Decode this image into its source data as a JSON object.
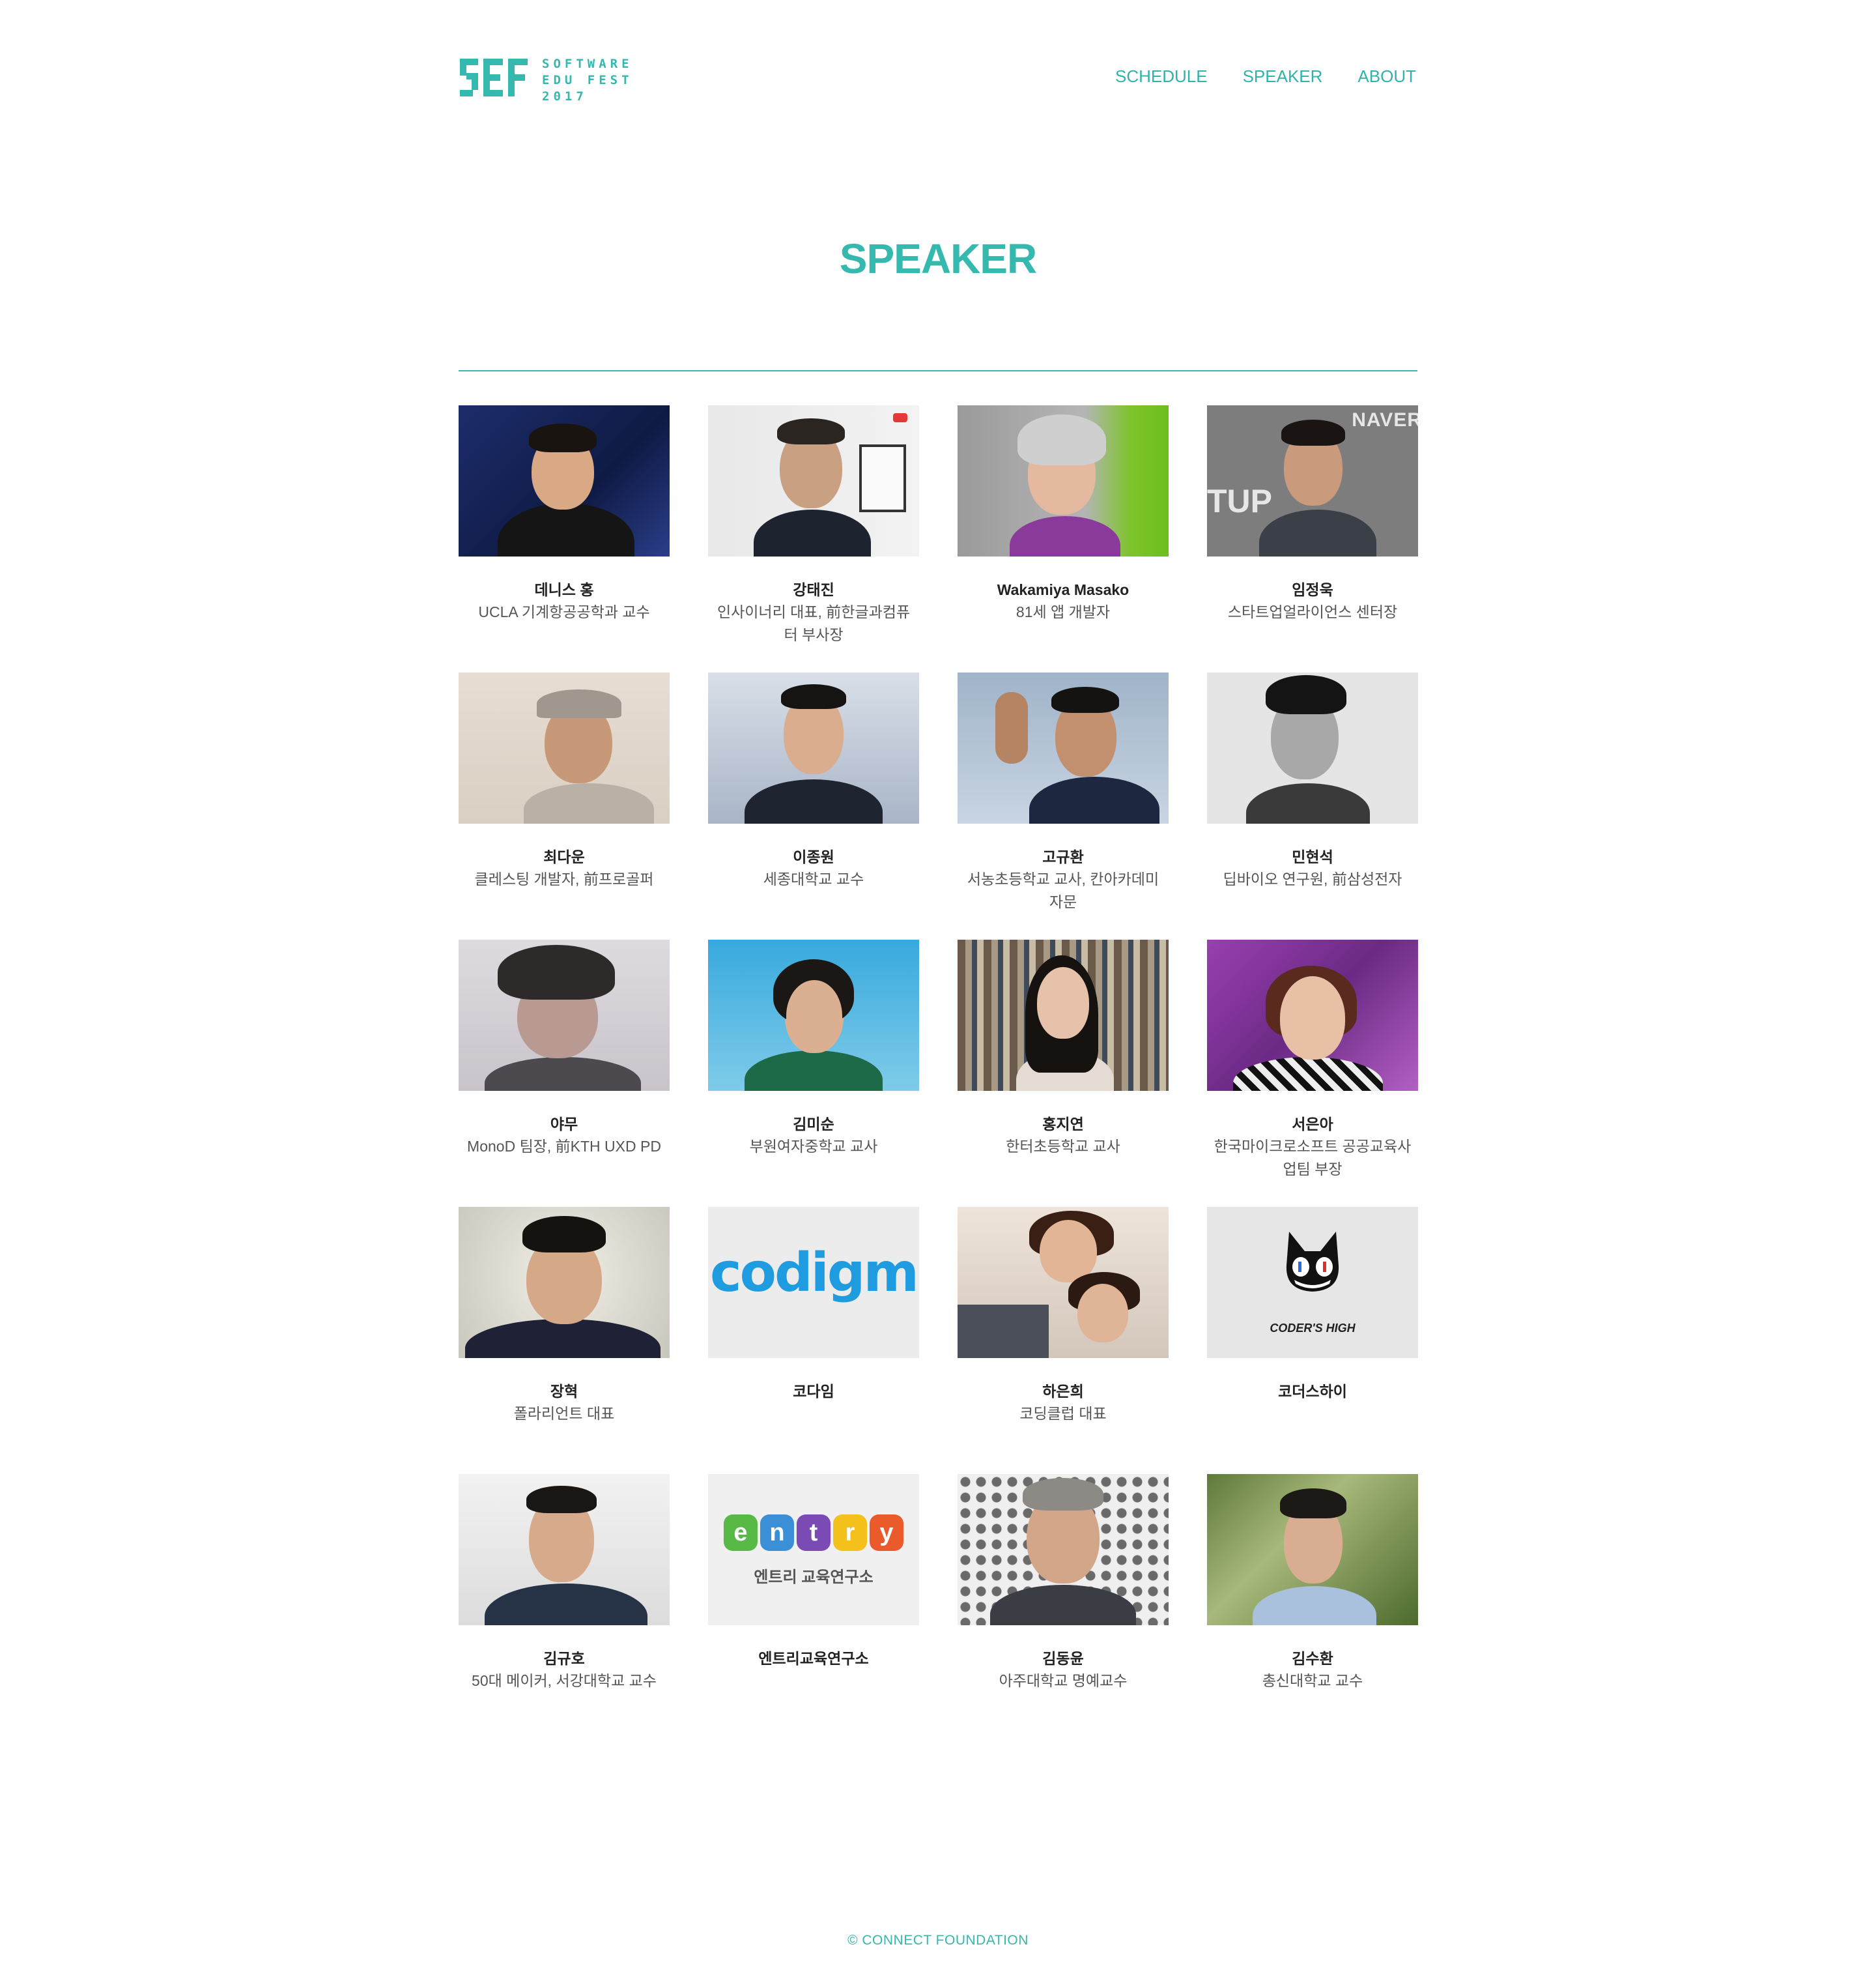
{
  "header": {
    "logo_lines": [
      "SOFTWARE",
      "EDU FEST",
      "2017"
    ],
    "nav": [
      "SCHEDULE",
      "SPEAKER",
      "ABOUT"
    ]
  },
  "page": {
    "title": "SPEAKER"
  },
  "speakers": [
    {
      "name": "데니스 홍",
      "role": "UCLA 기계항공공학과 교수"
    },
    {
      "name": "강태진",
      "role": "인사이너리 대표, 前한글과컴퓨터 부사장"
    },
    {
      "name": "Wakamiya Masako",
      "role": "81세 앱 개발자"
    },
    {
      "name": "임정욱",
      "role": "스타트업얼라이언스 센터장"
    },
    {
      "name": "최다운",
      "role": "클레스팅 개발자, 前프로골퍼"
    },
    {
      "name": "이종원",
      "role": "세종대학교 교수"
    },
    {
      "name": "고규환",
      "role": "서농초등학교 교사, 칸아카데미 자문"
    },
    {
      "name": "민현석",
      "role": "딥바이오 연구원, 前삼성전자"
    },
    {
      "name": "야무",
      "role": "MonoD 팀장, 前KTH UXD PD"
    },
    {
      "name": "김미순",
      "role": "부원여자중학교 교사"
    },
    {
      "name": "홍지연",
      "role": "한터초등학교 교사"
    },
    {
      "name": "서은아",
      "role": "한국마이크로소프트 공공교육사업팀 부장"
    },
    {
      "name": "장혁",
      "role": "폴라리언트 대표"
    },
    {
      "name": "코다임",
      "role": ""
    },
    {
      "name": "하은희",
      "role": "코딩클럽 대표"
    },
    {
      "name": "코더스하이",
      "role": ""
    },
    {
      "name": "김규호",
      "role": "50대 메이커, 서강대학교 교수"
    },
    {
      "name": "엔트리교육연구소",
      "role": ""
    },
    {
      "name": "김동윤",
      "role": "아주대학교 명예교수"
    },
    {
      "name": "김수환",
      "role": "총신대학교 교수"
    }
  ],
  "logos": {
    "codigm": "codigm",
    "coders_high": "CODER'S HIGH",
    "entry_letters": [
      "e",
      "n",
      "t",
      "r",
      "y"
    ],
    "entry_caption": "엔트리 교육연구소",
    "naver_sign": "NAVER",
    "tup_sign": "TUP"
  },
  "footer": {
    "text": "© CONNECT FOUNDATION"
  },
  "colors": {
    "accent": "#35b8ad"
  }
}
